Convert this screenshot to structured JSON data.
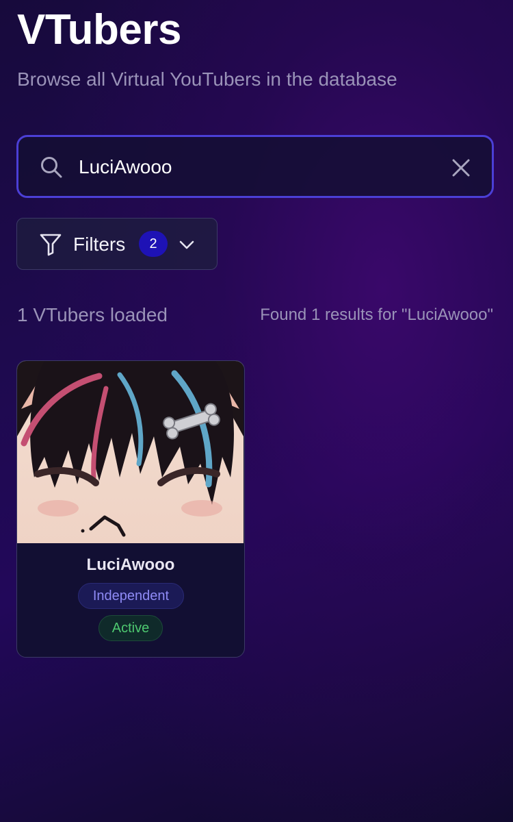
{
  "header": {
    "title": "VTubers",
    "subtitle": "Browse all Virtual YouTubers in the database"
  },
  "search": {
    "value": "LuciAwooo",
    "placeholder": "",
    "icon": "search-icon",
    "clear_icon": "close-icon"
  },
  "filters": {
    "label": "Filters",
    "active_count": "2",
    "icon": "filter-icon",
    "chevron": "chevron-down-icon"
  },
  "summary": {
    "loaded": "1 VTubers loaded",
    "results": "Found 1 results for \"LuciAwooo\""
  },
  "results": [
    {
      "name": "LuciAwooo",
      "affiliation": "Independent",
      "status": "Active"
    }
  ],
  "colors": {
    "search_border": "#4b3fd6",
    "filters_badge": "#1e12b5",
    "affiliation_text": "#8f8bf6",
    "status_text": "#4ec970"
  }
}
